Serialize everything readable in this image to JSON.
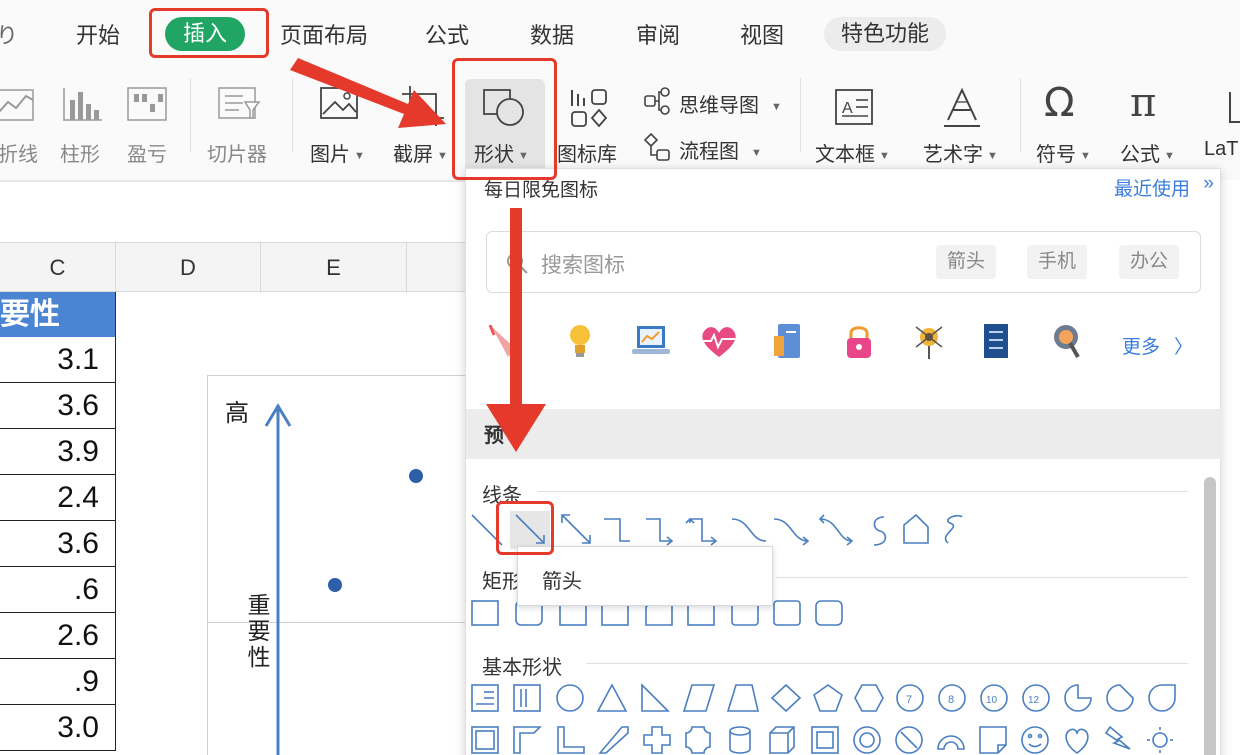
{
  "tabs": {
    "partial": "り",
    "start": "开始",
    "insert": "插入",
    "page_layout": "页面布局",
    "formula": "公式",
    "data": "数据",
    "review": "审阅",
    "view": "视图",
    "special": "特色功能"
  },
  "ribbon": {
    "line": "折线",
    "column": "柱形",
    "winloss": "盈亏",
    "slicer": "切片器",
    "picture": "图片",
    "screenshot": "截屏",
    "shapes": "形状",
    "icon_library": "图标库",
    "mindmap": "思维导图",
    "flowchart": "流程图",
    "textbox": "文本框",
    "wordart": "艺术字",
    "symbol": "符号",
    "equation": "公式",
    "latex": "LaT"
  },
  "sheet": {
    "columns": [
      "C",
      "D",
      "E"
    ],
    "header_cell": "要性",
    "values": [
      "3.1",
      "3.6",
      "3.9",
      "2.4",
      "3.6",
      ".6",
      "2.6",
      ".9",
      "3.0"
    ],
    "chart": {
      "y_top_label": "高",
      "y_axis_label": [
        "重",
        "要",
        "性"
      ]
    }
  },
  "chart_data": {
    "type": "scatter",
    "title": "",
    "ylabel": "重要性",
    "ytop": "高",
    "points_visible": 2
  },
  "panel": {
    "title": "每日限免图标",
    "recent": "最近使用",
    "search_placeholder": "搜索图标",
    "chips": [
      "箭头",
      "手机",
      "办公"
    ],
    "more": "更多",
    "preset": "预",
    "sections": {
      "lines": "线条",
      "rectangles": "矩形",
      "basic": "基本形状"
    },
    "tooltip": "箭头"
  },
  "colors": {
    "accent_green": "#20a565",
    "link_blue": "#3b7ddd",
    "annotation_red": "#e53a2b",
    "header_blue": "#4a84d2",
    "shape_blue": "#4a7fc1"
  }
}
